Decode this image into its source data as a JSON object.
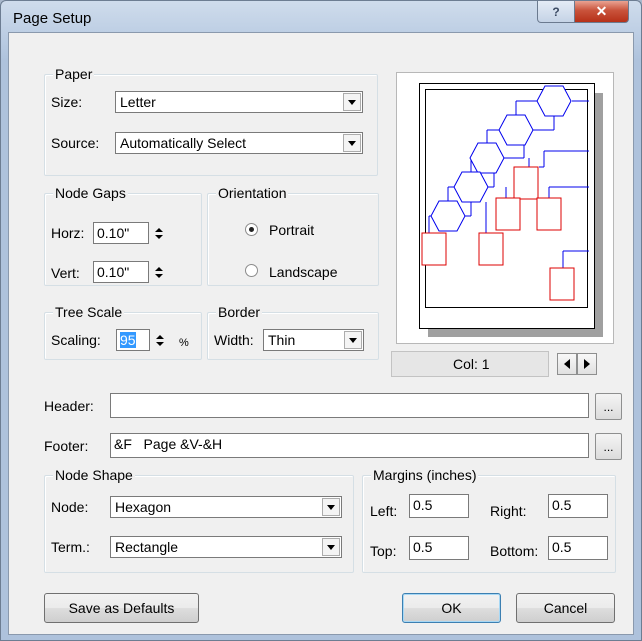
{
  "window": {
    "title": "Page Setup",
    "help_glyph": "?",
    "close_glyph": "✕"
  },
  "paper": {
    "group_label": "Paper",
    "size_label": "Size:",
    "size_value": "Letter",
    "source_label": "Source:",
    "source_value": "Automatically Select"
  },
  "node_gaps": {
    "group_label": "Node Gaps",
    "horz_label": "Horz:",
    "horz_value": "0.10\"",
    "vert_label": "Vert:",
    "vert_value": "0.10\""
  },
  "orientation": {
    "group_label": "Orientation",
    "portrait_label": "Portrait",
    "landscape_label": "Landscape",
    "selected": "Portrait"
  },
  "tree_scale": {
    "group_label": "Tree Scale",
    "scaling_label": "Scaling:",
    "scaling_value": "95",
    "unit": "%"
  },
  "border": {
    "group_label": "Border",
    "width_label": "Width:",
    "width_value": "Thin"
  },
  "preview": {
    "col_text": "Col: 1",
    "colors": {
      "internal_node": "#0000ee",
      "terminal_node": "#dd0000"
    }
  },
  "header": {
    "label": "Header:",
    "value": "",
    "browse_label": "..."
  },
  "footer": {
    "label": "Footer:",
    "value": "&F   Page &V-&H",
    "browse_label": "..."
  },
  "node_shape": {
    "group_label": "Node Shape",
    "node_label": "Node:",
    "node_value": "Hexagon",
    "term_label": "Term.:",
    "term_value": "Rectangle"
  },
  "margins": {
    "group_label": "Margins (inches)",
    "left_label": "Left:",
    "left_value": "0.5",
    "right_label": "Right:",
    "right_value": "0.5",
    "top_label": "Top:",
    "top_value": "0.5",
    "bottom_label": "Bottom:",
    "bottom_value": "0.5"
  },
  "buttons": {
    "save_defaults": "Save as Defaults",
    "ok": "OK",
    "cancel": "Cancel"
  }
}
